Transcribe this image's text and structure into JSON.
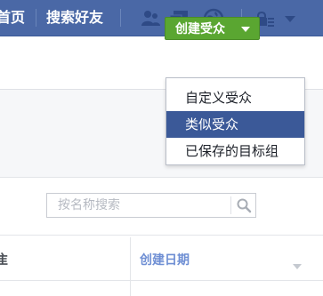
{
  "nav": {
    "home_label": "首页",
    "find_friends_label": "搜索好友",
    "icons": [
      "friend-requests-icon",
      "messages-icon",
      "notifications-icon",
      "privacy-icon",
      "account-menu-icon"
    ]
  },
  "toolbar": {
    "create_audience_label": "创建受众"
  },
  "create_audience_menu": {
    "items": [
      {
        "label": "自定义受众",
        "active": false
      },
      {
        "label": "类似受众",
        "active": true
      },
      {
        "label": "已保存的目标组",
        "active": false
      }
    ]
  },
  "search": {
    "placeholder": "按名称搜索"
  },
  "table": {
    "name_header_fragment": "隹",
    "created_date_header": "创建日期"
  },
  "colors": {
    "navbar": "#4a68a6",
    "primary_button": "#5aa631",
    "menu_highlight": "#3b5998",
    "link_header": "#6f8fd4"
  }
}
